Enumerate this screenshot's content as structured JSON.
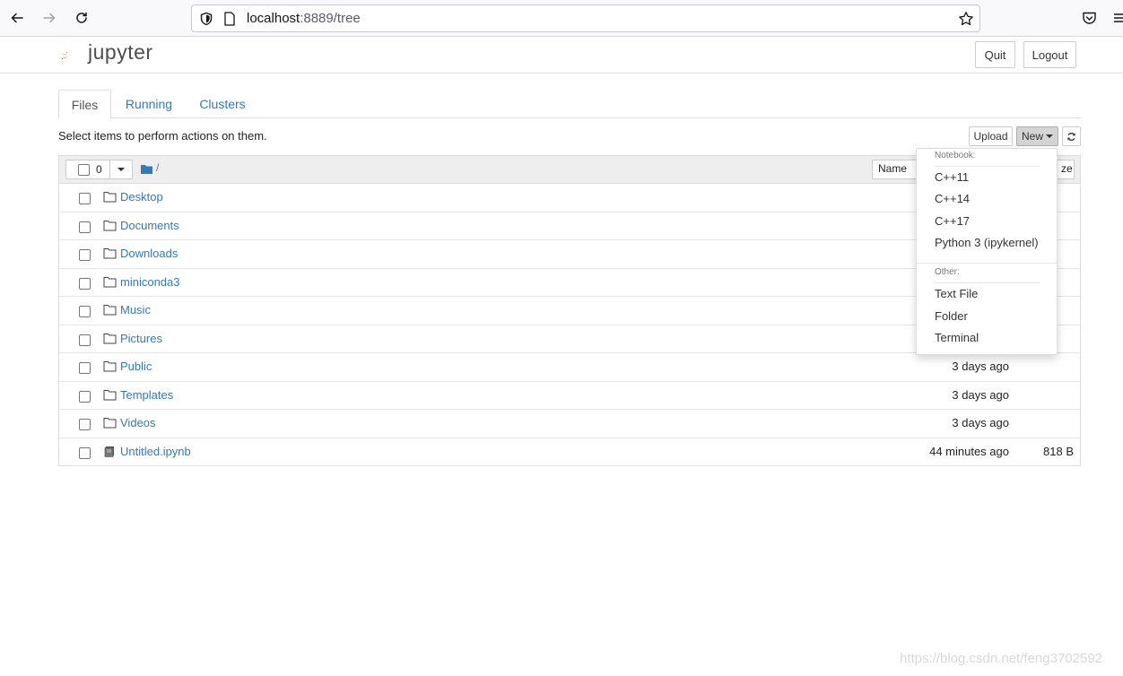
{
  "browser": {
    "url_host": "localhost",
    "url_rest": ":8889/tree"
  },
  "header": {
    "logo_text": "jupyter",
    "quit_label": "Quit",
    "logout_label": "Logout"
  },
  "tabs": [
    {
      "label": "Files",
      "active": true
    },
    {
      "label": "Running",
      "active": false
    },
    {
      "label": "Clusters",
      "active": false
    }
  ],
  "toolbar": {
    "hint": "Select items to perform actions on them.",
    "upload_label": "Upload",
    "new_label": "New"
  },
  "list_header": {
    "selected_count": "0",
    "breadcrumb": "/",
    "name_sort_label": "Name",
    "size_sort_label": "ze"
  },
  "files": [
    {
      "name": "Desktop",
      "type": "folder",
      "modified": "",
      "size": ""
    },
    {
      "name": "Documents",
      "type": "folder",
      "modified": "",
      "size": ""
    },
    {
      "name": "Downloads",
      "type": "folder",
      "modified": "",
      "size": ""
    },
    {
      "name": "miniconda3",
      "type": "folder",
      "modified": "",
      "size": ""
    },
    {
      "name": "Music",
      "type": "folder",
      "modified": "",
      "size": ""
    },
    {
      "name": "Pictures",
      "type": "folder",
      "modified": "",
      "size": ""
    },
    {
      "name": "Public",
      "type": "folder",
      "modified": "3 days ago",
      "size": ""
    },
    {
      "name": "Templates",
      "type": "folder",
      "modified": "3 days ago",
      "size": ""
    },
    {
      "name": "Videos",
      "type": "folder",
      "modified": "3 days ago",
      "size": ""
    },
    {
      "name": "Untitled.ipynb",
      "type": "notebook",
      "modified": "44 minutes ago",
      "size": "818 B"
    }
  ],
  "new_menu": {
    "notebook_header": "Notebook:",
    "notebook_items": [
      "C++11",
      "C++14",
      "C++17",
      "Python 3 (ipykernel)"
    ],
    "other_header": "Other:",
    "other_items": [
      "Text File",
      "Folder",
      "Terminal"
    ]
  },
  "watermark": "https://blog.csdn.net/feng3702592",
  "colors": {
    "link": "#337ab7",
    "jupyter_orange": "#f37726"
  }
}
